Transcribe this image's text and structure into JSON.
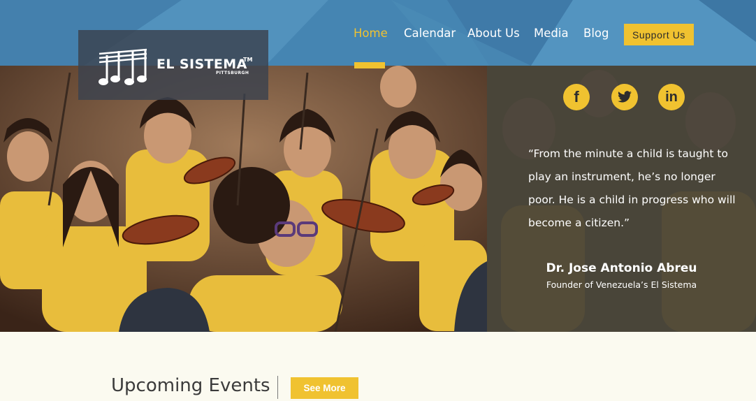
{
  "brand": {
    "name": "EL SISTEMA",
    "trademark": "TM",
    "location": "PITTSBURGH"
  },
  "nav": {
    "items": [
      {
        "label": "Home",
        "active": true
      },
      {
        "label": "Calendar",
        "active": false
      },
      {
        "label": "About Us",
        "active": false
      },
      {
        "label": "Media",
        "active": false
      },
      {
        "label": "Blog",
        "active": false
      }
    ],
    "cta_label": "Support Us"
  },
  "hero": {
    "image_icon": "children-violin-photo"
  },
  "quote": {
    "text": "“From the minute a child is taught to play an instrument, he’s no longer poor. He is a child in progress who will become a citizen.”",
    "author": "Dr. Jose Antonio Abreu",
    "role": "Founder of Venezuela’s El Sistema"
  },
  "social": [
    {
      "icon": "facebook-icon",
      "glyph": "f"
    },
    {
      "icon": "twitter-icon",
      "glyph": ""
    },
    {
      "icon": "linkedin-icon",
      "glyph": "in"
    }
  ],
  "events": {
    "title": "Upcoming Events",
    "see_more_label": "See More"
  },
  "colors": {
    "header_blue": "#4a88b5",
    "accent_yellow": "#f0c230",
    "page_bg": "#fbfaf0"
  }
}
